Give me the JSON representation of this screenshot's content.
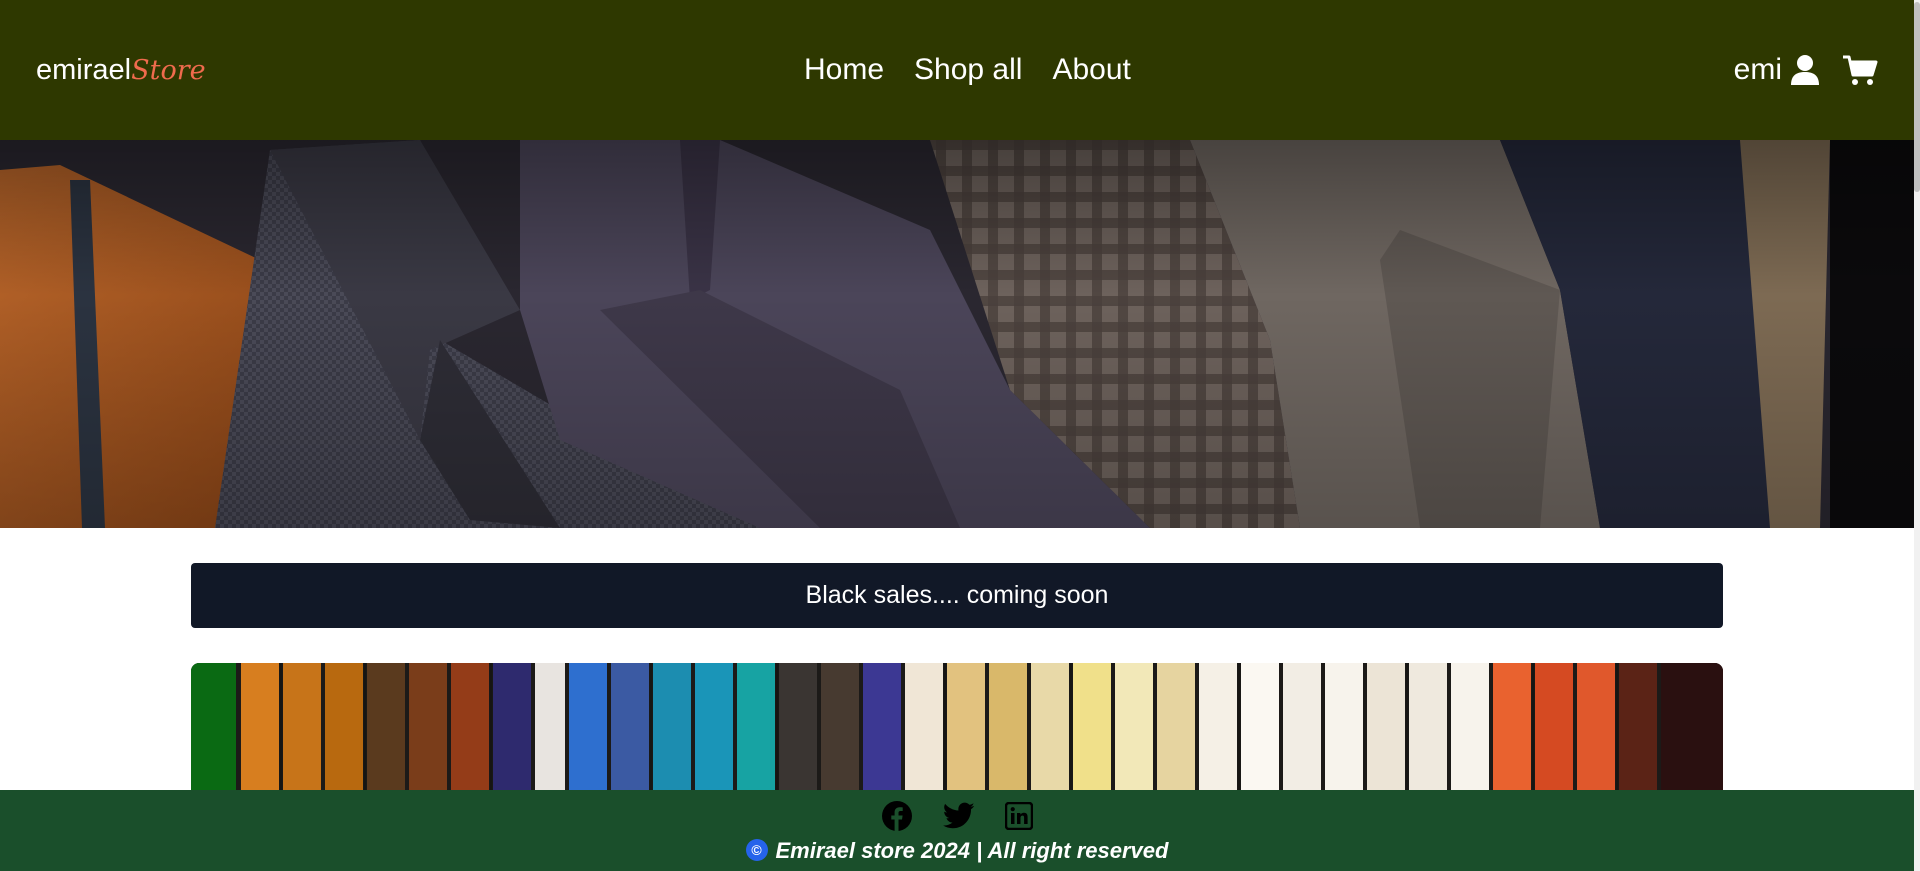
{
  "header": {
    "brand_main": "emirael",
    "brand_accent": "Store",
    "nav": [
      {
        "label": "Home"
      },
      {
        "label": "Shop all"
      },
      {
        "label": "About"
      }
    ],
    "user_name": "emi",
    "icons": [
      "user-icon",
      "cart-icon"
    ],
    "bg_color": "#2e3800",
    "accent_color": "#ef6b4d"
  },
  "hero": {
    "image": "rack-of-tweed-suit-jackets"
  },
  "promo": {
    "text": "Black sales.... coming soon",
    "bg_color": "#111827"
  },
  "product": {
    "image": "rack-of-colorful-shirts"
  },
  "footer": {
    "social_icons": [
      "facebook-icon",
      "twitter-icon",
      "linkedin-icon"
    ],
    "copyright": "Emirael store 2024 | All right reserved",
    "copyright_symbol": "©",
    "bg_color": "#1a4f2b"
  }
}
